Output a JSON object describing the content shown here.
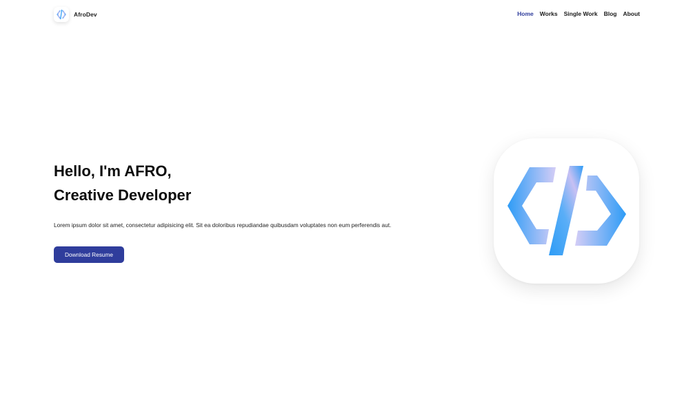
{
  "brand": {
    "name": "AfroDev",
    "logo_icon": "code-brackets-icon"
  },
  "nav": {
    "items": [
      {
        "label": "Home",
        "active": true
      },
      {
        "label": "Works",
        "active": false
      },
      {
        "label": "Single Work",
        "active": false
      },
      {
        "label": "Blog",
        "active": false
      },
      {
        "label": "About",
        "active": false
      }
    ]
  },
  "hero": {
    "title_line1": "Hello, I'm AFRO,",
    "title_line2": "Creative Developer",
    "description": "Lorem ipsum dolor sit amet, consectetur adipisicing elit. Sit ea doloribus repudiandae quibusdam voluptates non eum perferendis aut.",
    "cta_label": "Download Resume"
  },
  "colors": {
    "accent": "#2f3d9c",
    "logo_gradient_start": "#2e9cf6",
    "logo_gradient_end": "#c9c2f3"
  }
}
